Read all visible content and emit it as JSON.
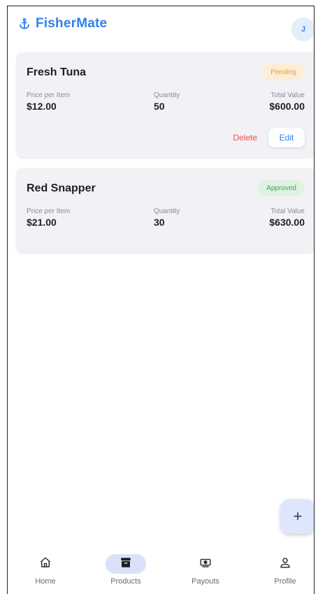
{
  "app": {
    "title": "FisherMate",
    "avatar_initial": "J"
  },
  "colors": {
    "accent": "#2f80ed",
    "pending": "#f29a3d",
    "approved": "#3fa35a",
    "delete": "#ef4a4a"
  },
  "products": [
    {
      "name": "Fresh Tuna",
      "status": "Pending",
      "price_label": "Price per Item",
      "price": "$12.00",
      "qty_label": "Quantity",
      "qty": "50",
      "total_label": "Total Value",
      "total": "$600.00",
      "delete_label": "Delete",
      "edit_label": "Edit"
    },
    {
      "name": "Red Snapper",
      "status": "Approved",
      "price_label": "Price per Item",
      "price": "$21.00",
      "qty_label": "Quantity",
      "qty": "30",
      "total_label": "Total Value",
      "total": "$630.00"
    }
  ],
  "fab": {
    "label": "+",
    "icon": "plus-icon"
  },
  "nav": {
    "items": [
      {
        "label": "Home",
        "icon": "home-icon"
      },
      {
        "label": "Products",
        "icon": "archive-icon",
        "active": true
      },
      {
        "label": "Payouts",
        "icon": "cash-icon"
      },
      {
        "label": "Profile",
        "icon": "user-icon"
      }
    ]
  }
}
